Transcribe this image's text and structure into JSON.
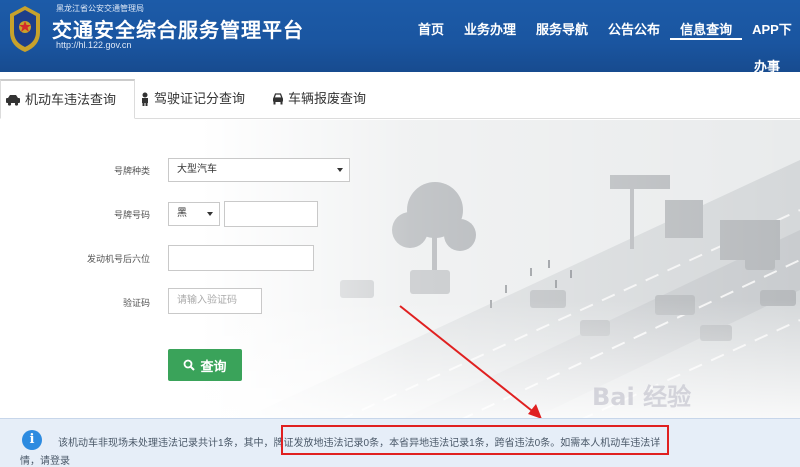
{
  "header": {
    "org_small": "黑龙江省公安交通管理局",
    "title": "交通安全综合服务管理平台",
    "url": "http://hl.122.gov.cn",
    "nav": [
      "首页",
      "业务办理",
      "服务导航",
      "公告公布",
      "信息查询",
      "APP下"
    ],
    "nav_active_index": 4,
    "nav_second": "办事"
  },
  "tabs": [
    {
      "label": "机动车违法查询",
      "icon": "car-icon",
      "active": true
    },
    {
      "label": "驾驶证记分查询",
      "icon": "person-icon",
      "active": false
    },
    {
      "label": "车辆报废查询",
      "icon": "car-front-icon",
      "active": false
    }
  ],
  "form": {
    "plate_type_label": "号牌种类",
    "plate_type_value": "大型汽车",
    "plate_number_label": "号牌号码",
    "plate_prefix_value": "黑",
    "plate_number_value": "",
    "engine_label": "发动机号后六位",
    "engine_value": "",
    "captcha_label": "验证码",
    "captcha_placeholder": "请输入验证码",
    "query_button": "查询"
  },
  "notice": {
    "text_prefix": "该机动车非现场未处理违法记录共计1条，",
    "text_highlight": "其中，牌证发放地违法记录0条，本省异地违法记录1条，跨省违法0条。",
    "text_suffix": "如需本人机动车违法详",
    "line2": "情，请登录"
  },
  "watermark": "Bai 经验",
  "colors": {
    "header_bg": "#1a55a0",
    "query_button": "#3aa35a",
    "notice_bg": "#e6eef8",
    "highlight": "#e02020",
    "info_icon": "#2d8be0"
  }
}
